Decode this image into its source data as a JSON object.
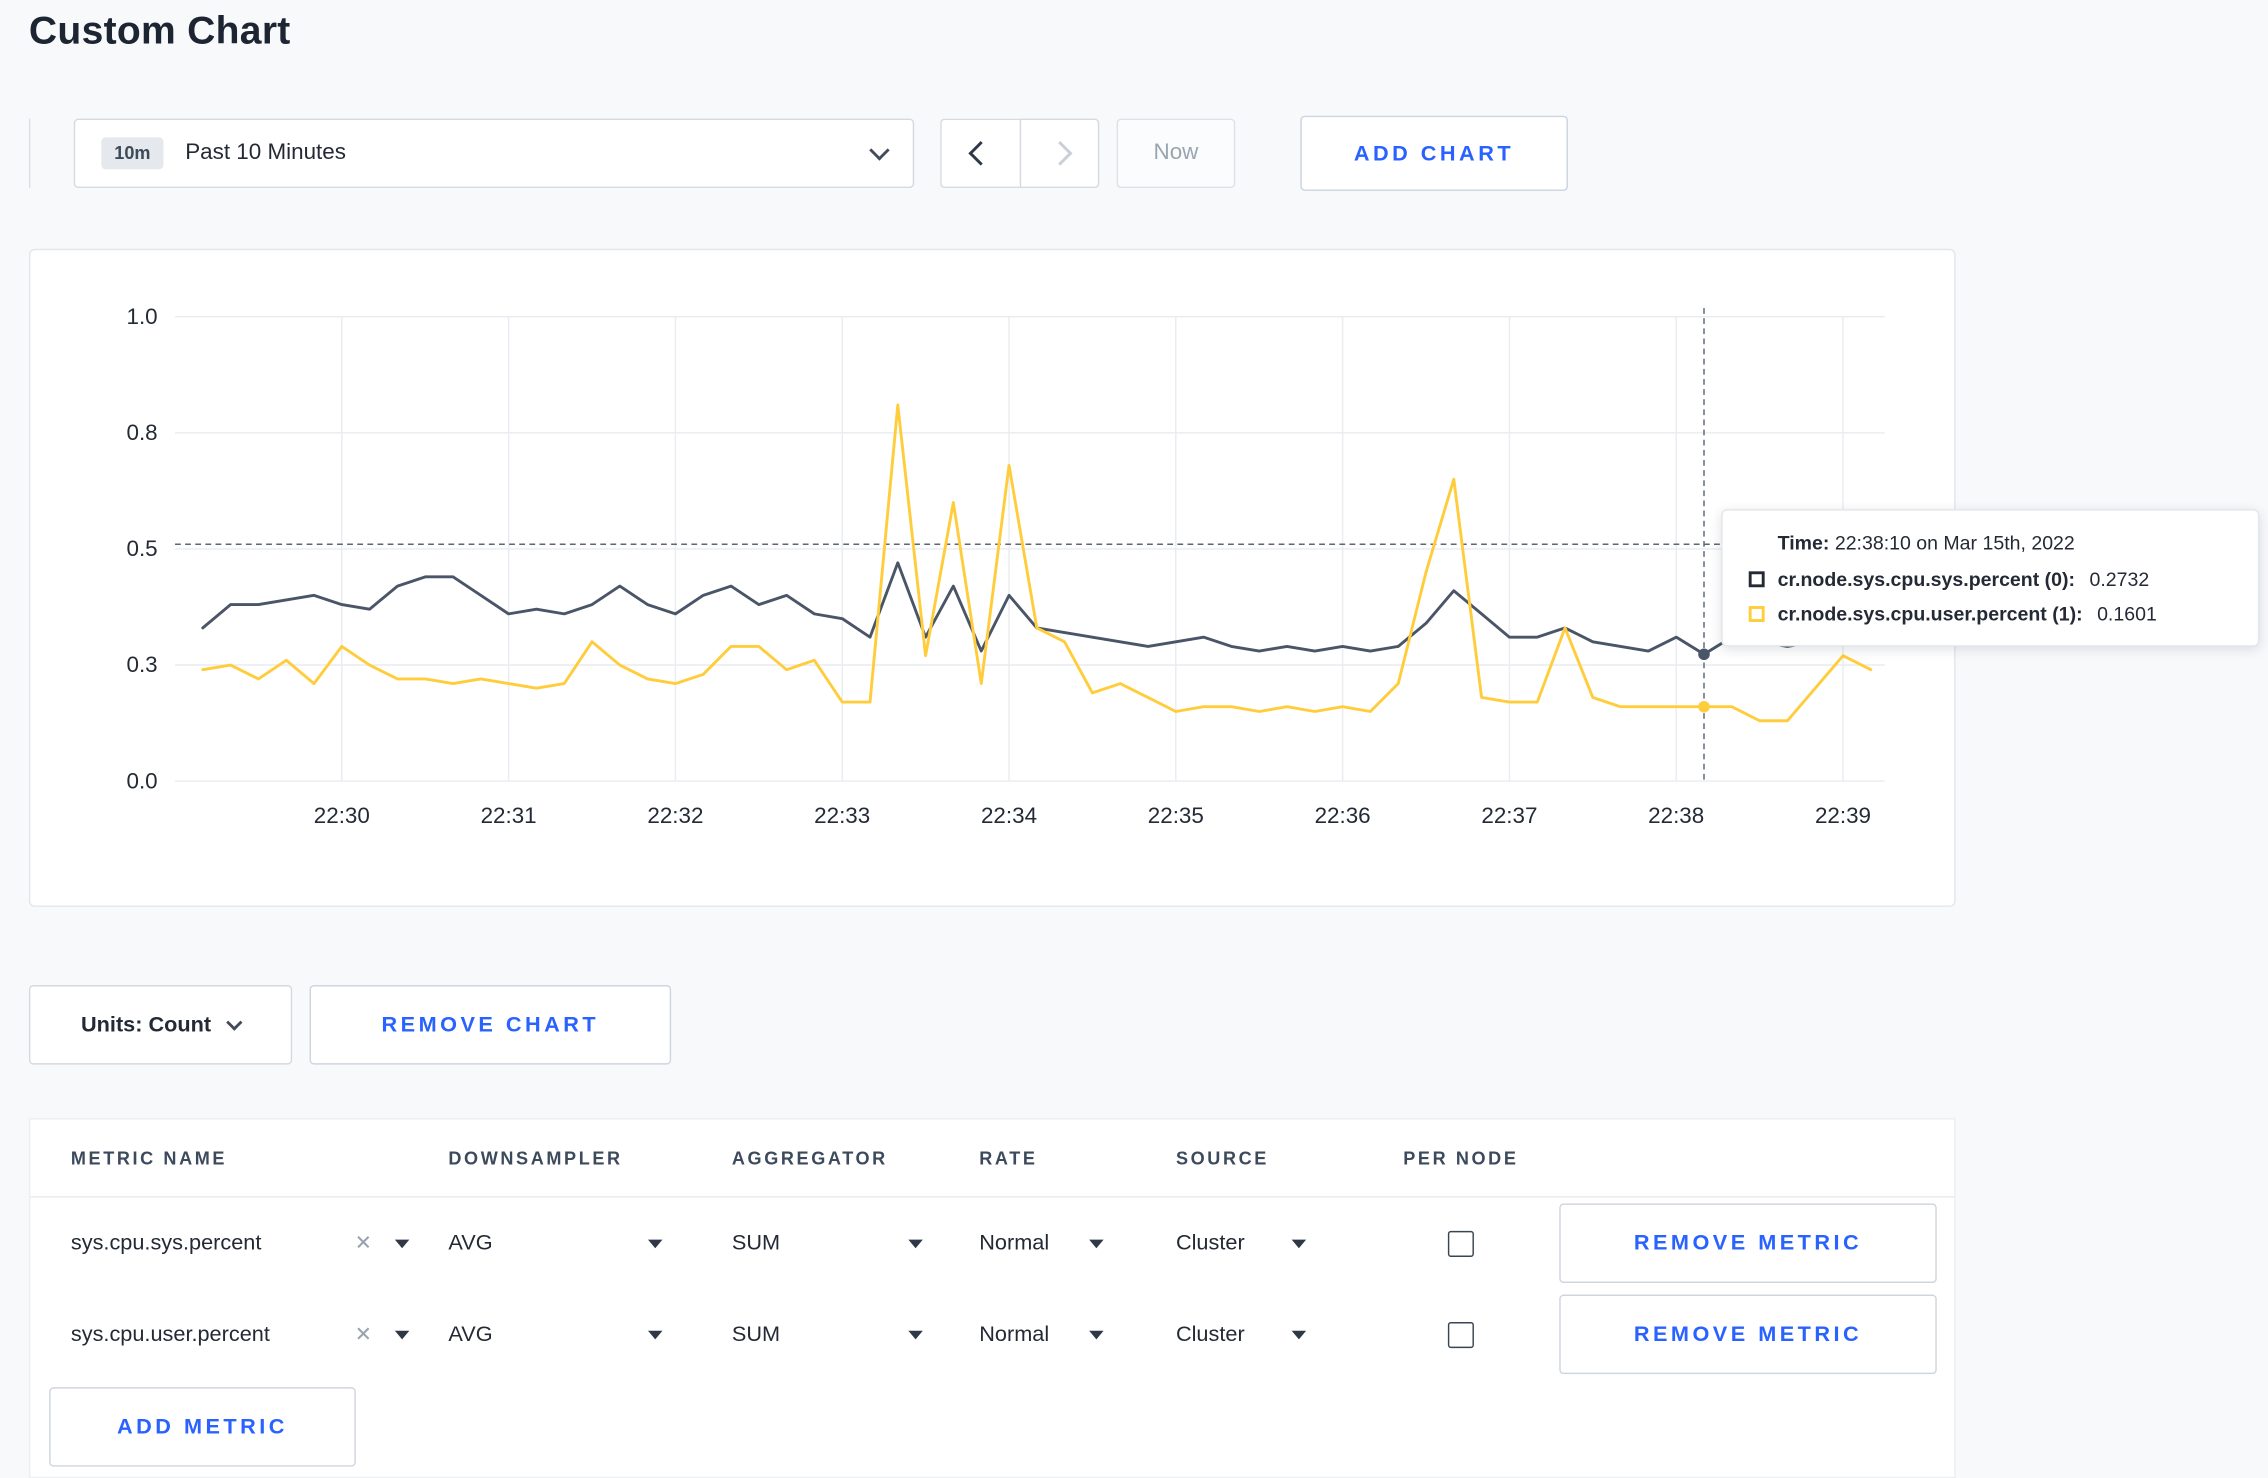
{
  "page": {
    "title": "Custom Chart"
  },
  "toolbar": {
    "range_badge": "10m",
    "range_label": "Past 10 Minutes",
    "now_label": "Now",
    "add_chart_label": "ADD CHART"
  },
  "chart_controls": {
    "units_label": "Units: Count",
    "remove_chart_label": "REMOVE CHART",
    "add_metric_label": "ADD METRIC"
  },
  "tooltip": {
    "time_label": "Time:",
    "time_value": "22:38:10 on Mar 15th, 2022",
    "series": [
      {
        "label": "cr.node.sys.cpu.sys.percent (0):",
        "value": "0.2732",
        "color": "#242a35"
      },
      {
        "label": "cr.node.sys.cpu.user.percent (1):",
        "value": "0.1601",
        "color": "#ffcd3c"
      }
    ]
  },
  "metrics_table": {
    "headers": [
      "METRIC NAME",
      "DOWNSAMPLER",
      "AGGREGATOR",
      "RATE",
      "SOURCE",
      "PER NODE"
    ],
    "rows": [
      {
        "metric": "sys.cpu.sys.percent",
        "downsampler": "AVG",
        "aggregator": "SUM",
        "rate": "Normal",
        "source": "Cluster",
        "per_node_checked": false,
        "remove_label": "REMOVE METRIC"
      },
      {
        "metric": "sys.cpu.user.percent",
        "downsampler": "AVG",
        "aggregator": "SUM",
        "rate": "Normal",
        "source": "Cluster",
        "per_node_checked": false,
        "remove_label": "REMOVE METRIC"
      }
    ]
  },
  "colors": {
    "accent_blue": "#2962ff",
    "series_sys": "#4a5568",
    "series_user": "#ffcd3c",
    "grid": "#e9ecf0",
    "crosshair": "#5b6676"
  },
  "chart_data": {
    "type": "line",
    "title": "",
    "ylim": [
      0,
      1
    ],
    "y_ticks": [
      0,
      0.25,
      0.5,
      0.75,
      1
    ],
    "y_tick_labels": [
      "0.0",
      "0.3",
      "0.5",
      "0.8",
      "1.0"
    ],
    "x_tick_labels": [
      "22:30",
      "22:31",
      "22:32",
      "22:33",
      "22:34",
      "22:35",
      "22:36",
      "22:37",
      "22:38",
      "22:39"
    ],
    "x_tick_minutes": [
      30,
      31,
      32,
      33,
      34,
      35,
      36,
      37,
      38,
      39
    ],
    "x_range_minutes": [
      29.0,
      39.25
    ],
    "start_time": "22:29:10",
    "start_minute": 29.16667,
    "interval_seconds": 10,
    "interval_minutes": 0.1666667,
    "grid": true,
    "legend_position": "tooltip",
    "crosshair": {
      "time": "22:38:10",
      "minute": 38.16667,
      "hline_value": 0.51,
      "point_index": 54
    },
    "series": [
      {
        "name": "cr.node.sys.cpu.sys.percent",
        "color": "#4a5568",
        "values": [
          0.33,
          0.38,
          0.38,
          0.39,
          0.4,
          0.38,
          0.37,
          0.42,
          0.44,
          0.44,
          0.4,
          0.36,
          0.37,
          0.36,
          0.38,
          0.42,
          0.38,
          0.36,
          0.4,
          0.42,
          0.38,
          0.4,
          0.36,
          0.35,
          0.31,
          0.47,
          0.31,
          0.42,
          0.28,
          0.4,
          0.33,
          0.32,
          0.31,
          0.3,
          0.29,
          0.3,
          0.31,
          0.29,
          0.28,
          0.29,
          0.28,
          0.29,
          0.28,
          0.29,
          0.34,
          0.41,
          0.36,
          0.31,
          0.31,
          0.33,
          0.3,
          0.29,
          0.28,
          0.31,
          0.2732,
          0.31,
          0.3,
          0.29,
          0.3,
          0.31,
          0.3
        ]
      },
      {
        "name": "cr.node.sys.cpu.user.percent",
        "color": "#ffcd3c",
        "values": [
          0.24,
          0.25,
          0.22,
          0.26,
          0.21,
          0.29,
          0.25,
          0.22,
          0.22,
          0.21,
          0.22,
          0.21,
          0.2,
          0.21,
          0.3,
          0.25,
          0.22,
          0.21,
          0.23,
          0.29,
          0.29,
          0.24,
          0.26,
          0.17,
          0.17,
          0.81,
          0.27,
          0.6,
          0.21,
          0.68,
          0.33,
          0.3,
          0.19,
          0.21,
          0.18,
          0.15,
          0.16,
          0.16,
          0.15,
          0.16,
          0.15,
          0.16,
          0.15,
          0.21,
          0.45,
          0.65,
          0.18,
          0.17,
          0.17,
          0.33,
          0.18,
          0.16,
          0.16,
          0.16,
          0.1601,
          0.16,
          0.13,
          0.13,
          0.2,
          0.27,
          0.24
        ]
      }
    ]
  }
}
